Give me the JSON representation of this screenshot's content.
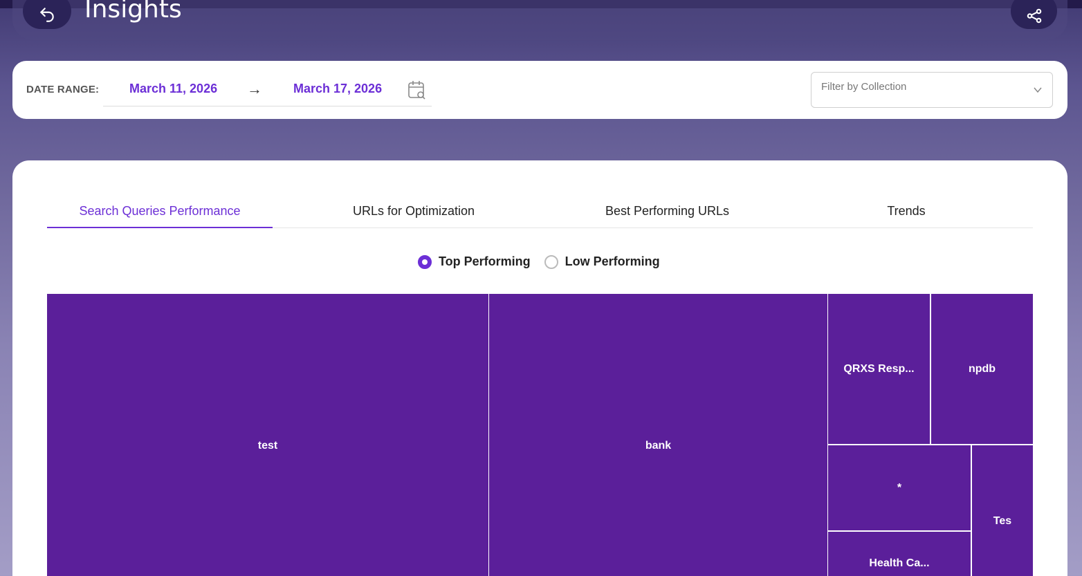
{
  "header": {
    "title": "Insights"
  },
  "date_filter": {
    "label": "DATE RANGE:",
    "start": "March 11, 2026",
    "arrow": "→",
    "end": "March 17, 2026"
  },
  "collection_filter": {
    "placeholder": "Filter by Collection"
  },
  "tabs": [
    {
      "label": "Search Queries Performance",
      "active": true
    },
    {
      "label": "URLs for Optimization",
      "active": false
    },
    {
      "label": "Best Performing URLs",
      "active": false
    },
    {
      "label": "Trends",
      "active": false
    }
  ],
  "performance_toggle": {
    "options": [
      {
        "label": "Top Performing",
        "selected": true
      },
      {
        "label": "Low Performing",
        "selected": false
      }
    ]
  },
  "treemap": {
    "tile_color": "#5b1f9a",
    "tiles": [
      {
        "label": "test"
      },
      {
        "label": "bank"
      },
      {
        "label": "QRXS Resp..."
      },
      {
        "label": "npdb"
      },
      {
        "label": "*"
      },
      {
        "label": "Tes"
      },
      {
        "label": "Health Ca..."
      }
    ]
  },
  "colors": {
    "accent": "#6c2fd6",
    "dark_button": "#2b2358"
  }
}
